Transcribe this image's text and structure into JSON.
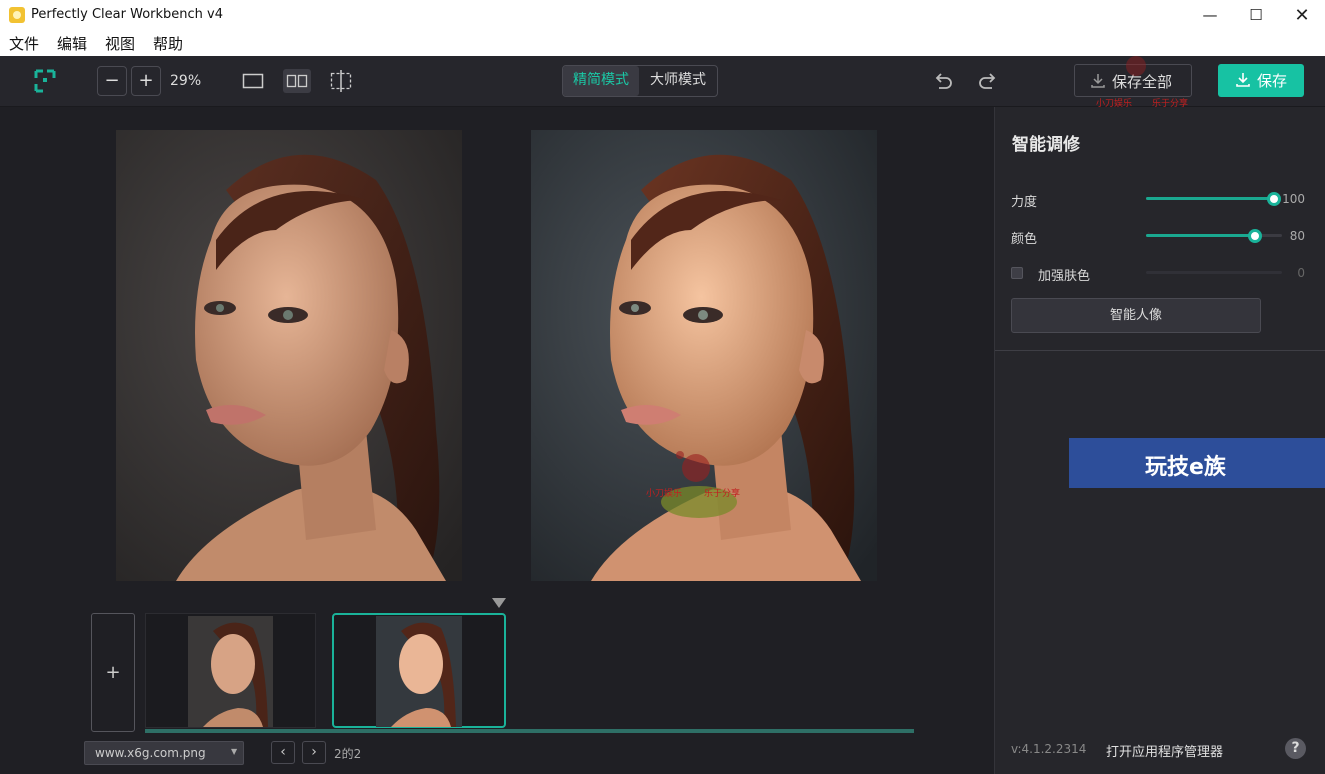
{
  "window": {
    "title": "Perfectly Clear Workbench v4"
  },
  "menu": [
    "文件",
    "编辑",
    "视图",
    "帮助"
  ],
  "toolbar": {
    "zoom_out": "−",
    "zoom_in": "+",
    "zoom_level": "29%",
    "modes": [
      "精简模式",
      "大师模式"
    ],
    "active_mode": "精简模式",
    "save_all_label": "保存全部",
    "save_label": "保存"
  },
  "panel": {
    "title": "智能调修",
    "sliders": [
      {
        "label": "力度",
        "value": "100",
        "fraction": 1.0
      },
      {
        "label": "颜色",
        "value": "80",
        "fraction": 0.8
      }
    ],
    "checkbox": {
      "label": "加强肤色",
      "value": "0",
      "checked": false
    },
    "portrait_button": "智能人像",
    "ad_text": "玩技e族",
    "version": "v:4.1.2.2314",
    "app_manager": "打开应用程序管理器",
    "help": "?"
  },
  "filmstrip": {
    "add_label": "+",
    "file_select": "www.x6g.com.png",
    "page_indicator": "2的2"
  },
  "watermark": {
    "text_left": "小刀娱乐",
    "text_right": "乐于分享"
  },
  "colors": {
    "accent": "#1ab39a",
    "save_button": "#17c2a3",
    "bg": "#1f1f24"
  }
}
